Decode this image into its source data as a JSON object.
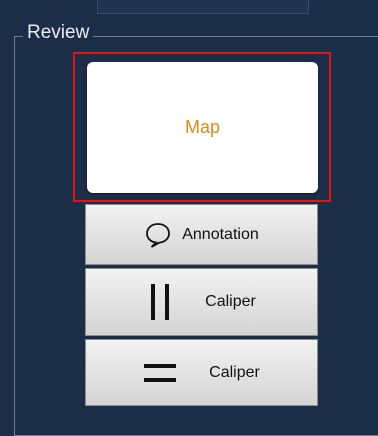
{
  "review_group": {
    "label": "Review",
    "map_button": {
      "label": "Map"
    },
    "annotation_button": {
      "label": "Annotation",
      "icon": "speech-bubble-icon"
    },
    "caliper_vertical_button": {
      "label": "Caliper",
      "icon": "vertical-caliper-icon"
    },
    "caliper_horizontal_button": {
      "label": "Caliper",
      "icon": "horizontal-caliper-icon"
    }
  },
  "colors": {
    "background": "#1b2d47",
    "map_label": "#e08a13",
    "highlight": "#e0141c"
  }
}
